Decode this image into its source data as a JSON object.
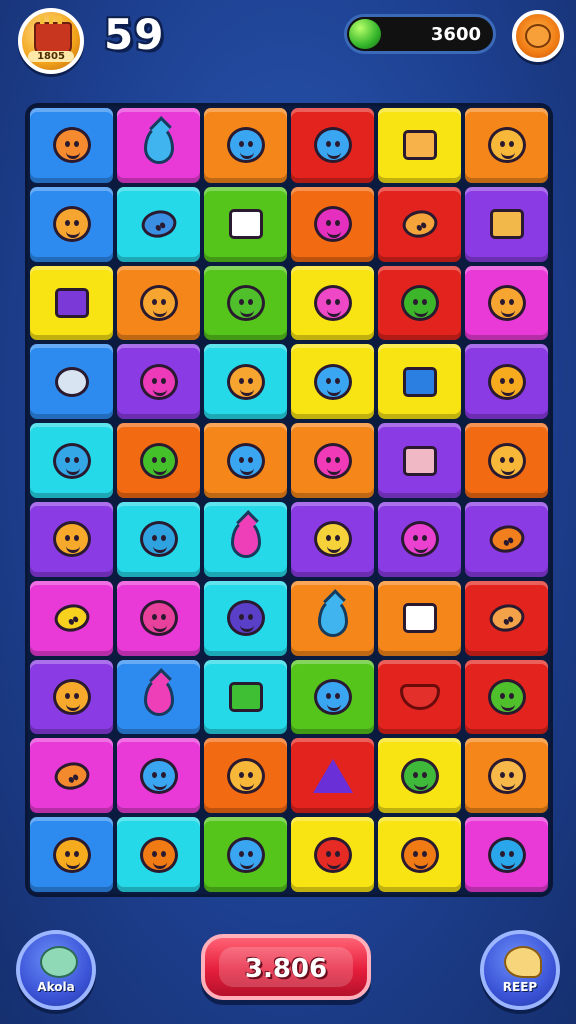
{
  "hud": {
    "level_badge": "1805",
    "score": "59",
    "coins": "3600"
  },
  "board": {
    "rows": [
      [
        {
          "color": "blue",
          "icon": "smiley-blob-icon"
        },
        {
          "color": "magenta",
          "icon": "water-drop-icon"
        },
        {
          "color": "orange",
          "icon": "blue-blob-icon"
        },
        {
          "color": "red",
          "icon": "blue-blob-icon"
        },
        {
          "color": "yellow",
          "icon": "toast-icon"
        },
        {
          "color": "orange",
          "icon": "smiley-face-icon"
        }
      ],
      [
        {
          "color": "blue",
          "icon": "star-face-icon"
        },
        {
          "color": "cyan",
          "icon": "rocket-icon"
        },
        {
          "color": "green",
          "icon": "bag-icon"
        },
        {
          "color": "darkorange",
          "icon": "berry-icon"
        },
        {
          "color": "red",
          "icon": "pencil-icon"
        },
        {
          "color": "purple",
          "icon": "cake-icon"
        }
      ],
      [
        {
          "color": "yellow",
          "icon": "box-icon"
        },
        {
          "color": "orange",
          "icon": "blob-icon"
        },
        {
          "color": "green",
          "icon": "frog-face-icon"
        },
        {
          "color": "yellow",
          "icon": "wink-face-icon"
        },
        {
          "color": "red",
          "icon": "apple-icon"
        },
        {
          "color": "magenta",
          "icon": "star-face-icon"
        }
      ],
      [
        {
          "color": "blue",
          "icon": "target-icon"
        },
        {
          "color": "purple",
          "icon": "ghost-icon"
        },
        {
          "color": "cyan",
          "icon": "star-face-icon"
        },
        {
          "color": "yellow",
          "icon": "blue-blob-icon"
        },
        {
          "color": "yellow",
          "icon": "radio-icon"
        },
        {
          "color": "purple",
          "icon": "sun-icon"
        }
      ],
      [
        {
          "color": "cyan",
          "icon": "bubble-icon"
        },
        {
          "color": "darkorange",
          "icon": "green-face-icon"
        },
        {
          "color": "orange",
          "icon": "blue-blob-icon"
        },
        {
          "color": "orange",
          "icon": "pink-face-icon"
        },
        {
          "color": "purple",
          "icon": "robot-icon"
        },
        {
          "color": "darkorange",
          "icon": "smiley-face-icon"
        }
      ],
      [
        {
          "color": "purple",
          "icon": "sun-face-icon"
        },
        {
          "color": "cyan",
          "icon": "splat-icon"
        },
        {
          "color": "cyan",
          "icon": "flame-icon"
        },
        {
          "color": "purple",
          "icon": "flower-face-icon"
        },
        {
          "color": "purple",
          "icon": "cube-face-icon"
        },
        {
          "color": "purple",
          "icon": "bird-icon"
        }
      ],
      [
        {
          "color": "magenta",
          "icon": "moon-icon"
        },
        {
          "color": "magenta",
          "icon": "monster-icon"
        },
        {
          "color": "cyan",
          "icon": "egg-icon"
        },
        {
          "color": "orange",
          "icon": "water-drop-icon"
        },
        {
          "color": "orange",
          "icon": "bag-icon"
        },
        {
          "color": "red",
          "icon": "ice-cream-icon"
        }
      ],
      [
        {
          "color": "purple",
          "icon": "sun-face-icon"
        },
        {
          "color": "blue",
          "icon": "flame-icon"
        },
        {
          "color": "cyan",
          "icon": "dice-icon"
        },
        {
          "color": "green",
          "icon": "blue-blob-icon"
        },
        {
          "color": "red",
          "icon": "heart-icon"
        },
        {
          "color": "red",
          "icon": "frog-face-icon"
        }
      ],
      [
        {
          "color": "magenta",
          "icon": "brush-icon"
        },
        {
          "color": "magenta",
          "icon": "blue-blob-icon"
        },
        {
          "color": "darkorange",
          "icon": "smiley-face-icon"
        },
        {
          "color": "red",
          "icon": "triangle-icon"
        },
        {
          "color": "yellow",
          "icon": "leaf-icon"
        },
        {
          "color": "orange",
          "icon": "cookie-icon"
        }
      ],
      [
        {
          "color": "blue",
          "icon": "sun-icon"
        },
        {
          "color": "cyan",
          "icon": "orange-ball-icon"
        },
        {
          "color": "green",
          "icon": "blue-blob-icon"
        },
        {
          "color": "yellow",
          "icon": "red-ball-icon"
        },
        {
          "color": "yellow",
          "icon": "orange-ball-icon"
        },
        {
          "color": "magenta",
          "icon": "spiky-ball-icon"
        }
      ]
    ]
  },
  "controls": {
    "left_button_label": "Akola",
    "center_value": "3.806",
    "right_button_label": "REEP"
  }
}
